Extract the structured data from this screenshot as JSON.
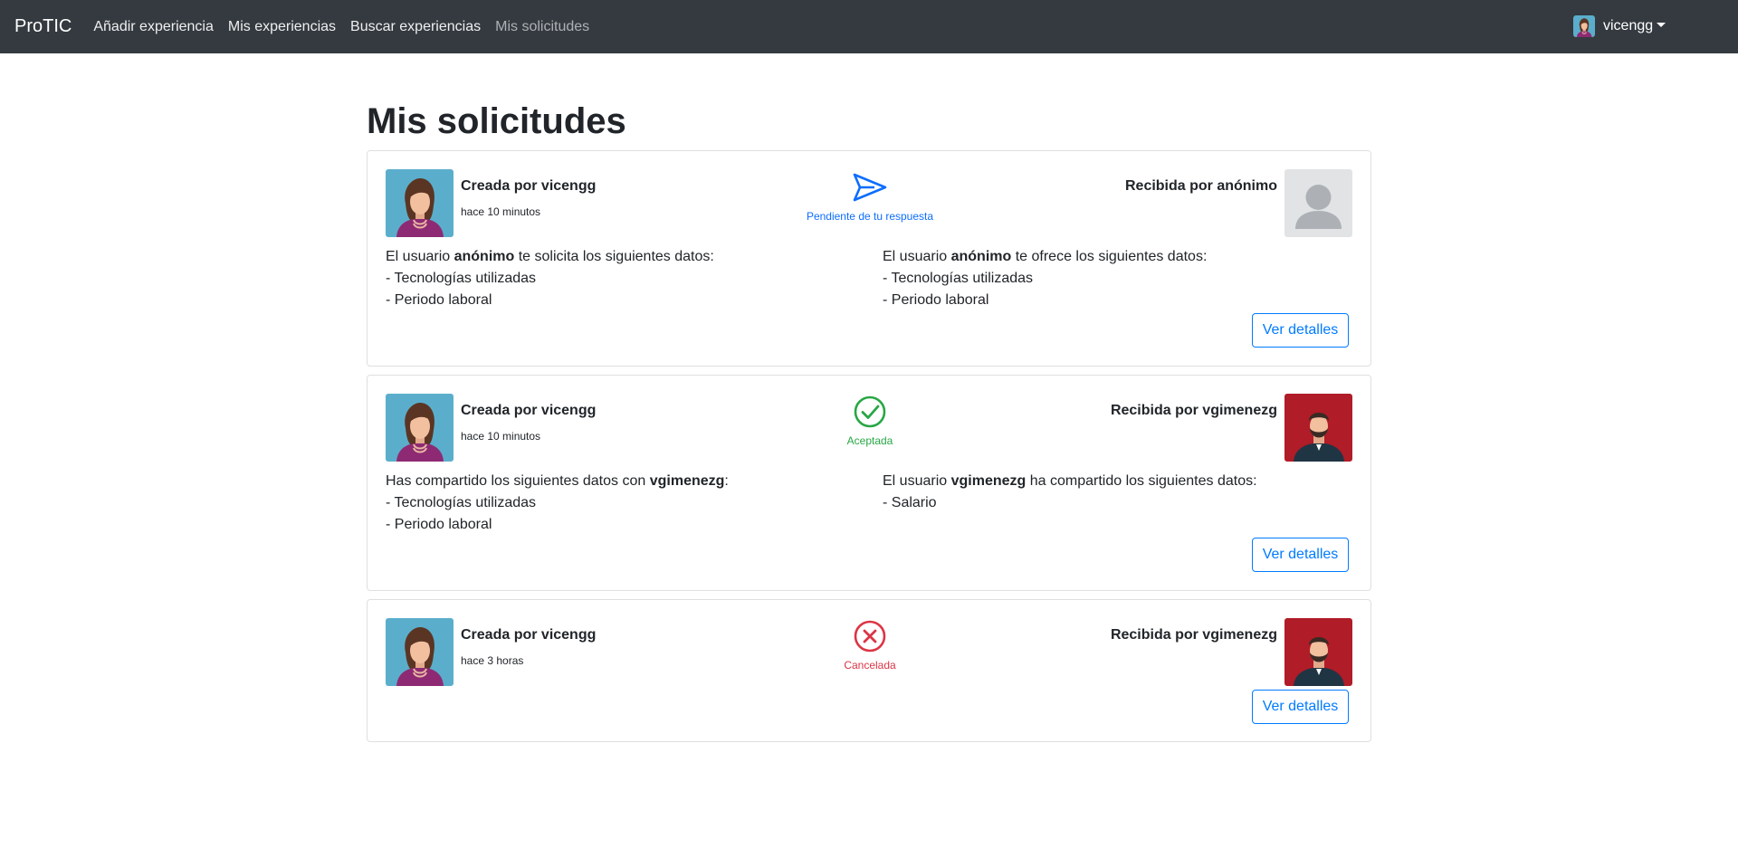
{
  "navbar": {
    "brand": "ProTIC",
    "links": [
      "Añadir experiencia",
      "Mis experiencias",
      "Buscar experiencias",
      "Mis solicitudes"
    ],
    "user": "vicengg"
  },
  "page": {
    "title": "Mis solicitudes"
  },
  "requests": [
    {
      "creator": "Creada por vicengg",
      "time": "hace 10 minutos",
      "status": "Pendiente de tu respuesta",
      "status_icon": "send-icon",
      "receiver": "Recibida por anónimo",
      "receiver_avatar": "anonymous",
      "left": {
        "pre": "El usuario ",
        "bold": "anónimo",
        "post": " te solicita los siguientes datos:",
        "items": [
          "- Tecnologías utilizadas",
          "- Periodo laboral"
        ]
      },
      "right": {
        "pre": "El usuario ",
        "bold": "anónimo",
        "post": " te ofrece los siguientes datos:",
        "items": [
          "- Tecnologías utilizadas",
          "- Periodo laboral"
        ]
      },
      "button": "Ver detalles"
    },
    {
      "creator": "Creada por vicengg",
      "time": "hace 10 minutos",
      "status": "Aceptada",
      "status_icon": "check-circle-icon",
      "receiver": "Recibida por vgimenezg",
      "receiver_avatar": "man",
      "left": {
        "pre": "Has compartido los siguientes datos con ",
        "bold": "vgimenezg",
        "post": ":",
        "items": [
          "- Tecnologías utilizadas",
          "- Periodo laboral"
        ]
      },
      "right": {
        "pre": "El usuario ",
        "bold": "vgimenezg",
        "post": " ha compartido los siguientes datos:",
        "items": [
          "- Salario"
        ]
      },
      "button": "Ver detalles"
    },
    {
      "creator": "Creada por vicengg",
      "time": "hace 3 horas",
      "status": "Cancelada",
      "status_icon": "x-circle-icon",
      "receiver": "Recibida por vgimenezg",
      "receiver_avatar": "man",
      "button": "Ver detalles"
    }
  ],
  "colors": {
    "navbar": "#343a40",
    "primary": "#007bff",
    "pending": "#0d6efd",
    "success": "#28a745",
    "danger": "#dc3545",
    "woman_bg": "#5aaecb",
    "man_bg": "#b01c27"
  }
}
